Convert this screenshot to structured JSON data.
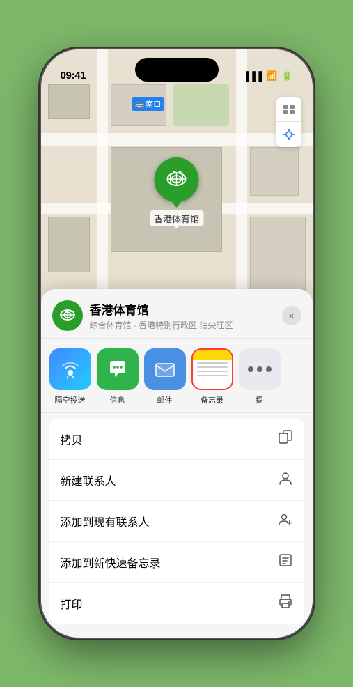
{
  "status_bar": {
    "time": "09:41",
    "location_icon": "▶"
  },
  "map": {
    "label": "南口",
    "pin_label": "香港体育馆"
  },
  "bottom_sheet": {
    "venue_name": "香港体育馆",
    "venue_subtitle": "综合体育馆 · 香港特别行政区 油尖旺区",
    "close_label": "×",
    "share_items": [
      {
        "id": "airdrop",
        "label": "隔空投送",
        "type": "airdrop"
      },
      {
        "id": "messages",
        "label": "信息",
        "type": "messages"
      },
      {
        "id": "mail",
        "label": "邮件",
        "type": "mail"
      },
      {
        "id": "notes",
        "label": "备忘录",
        "type": "notes",
        "selected": true
      },
      {
        "id": "more",
        "label": "提",
        "type": "more"
      }
    ],
    "action_items": [
      {
        "label": "拷贝",
        "icon": "copy"
      },
      {
        "label": "新建联系人",
        "icon": "person"
      },
      {
        "label": "添加到现有联系人",
        "icon": "person-add"
      },
      {
        "label": "添加到新快速备忘录",
        "icon": "note"
      },
      {
        "label": "打印",
        "icon": "print"
      }
    ]
  }
}
